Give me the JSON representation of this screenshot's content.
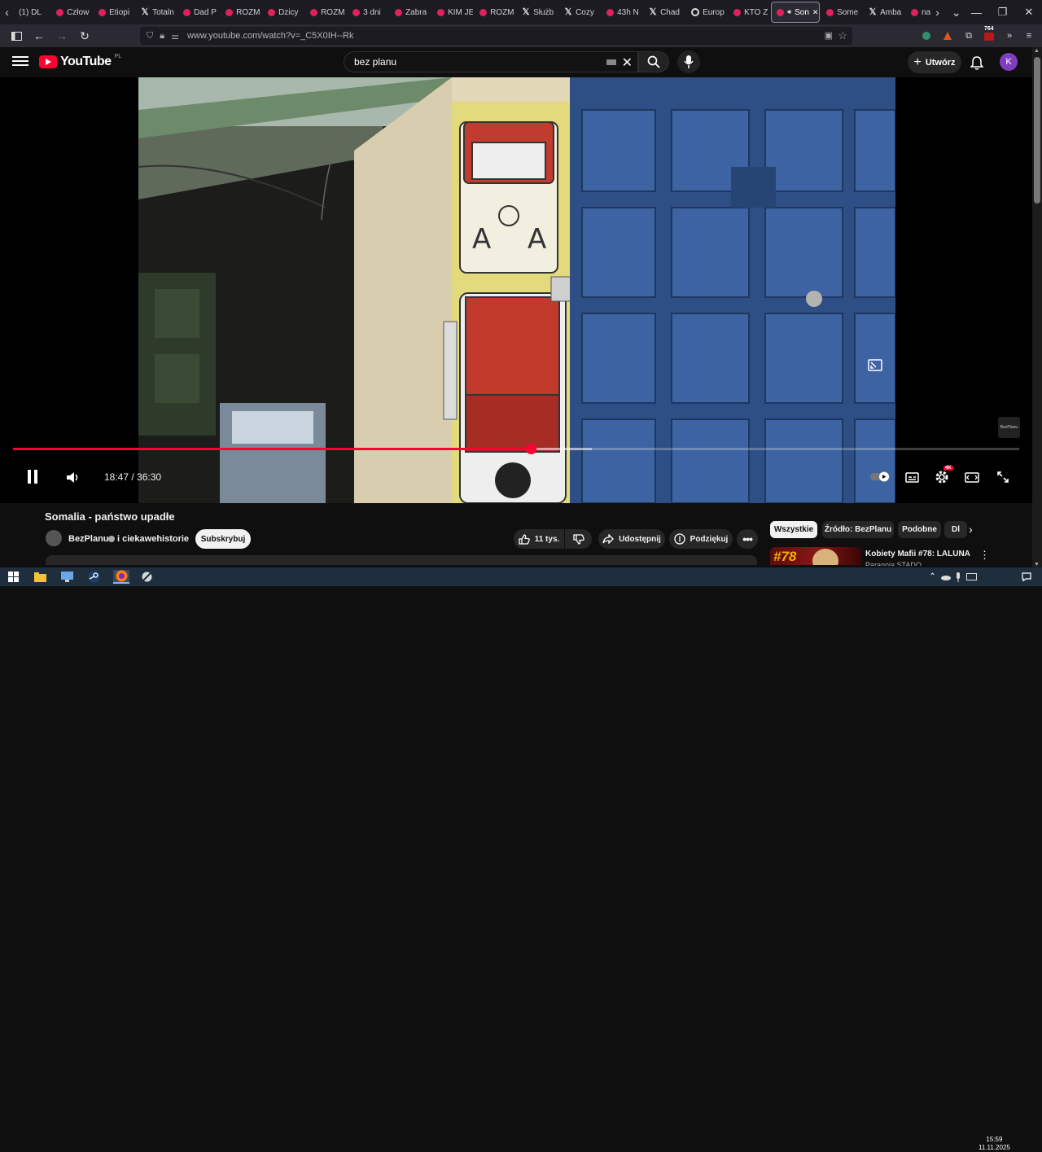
{
  "browser": {
    "tabs": [
      {
        "label": "(1) DL",
        "icon": "none"
      },
      {
        "label": "Człow",
        "icon": "youtube"
      },
      {
        "label": "Etiopi",
        "icon": "youtube"
      },
      {
        "label": "Totaln",
        "icon": "x"
      },
      {
        "label": "Dad P",
        "icon": "youtube"
      },
      {
        "label": "ROZM",
        "icon": "youtube"
      },
      {
        "label": "Dzicy",
        "icon": "youtube"
      },
      {
        "label": "ROZM",
        "icon": "youtube"
      },
      {
        "label": "3 dni",
        "icon": "youtube"
      },
      {
        "label": "Zabra",
        "icon": "youtube"
      },
      {
        "label": "KIM JE",
        "icon": "youtube"
      },
      {
        "label": "ROZM",
        "icon": "youtube"
      },
      {
        "label": "Służb",
        "icon": "x"
      },
      {
        "label": "Cozy",
        "icon": "x"
      },
      {
        "label": "43h N",
        "icon": "youtube"
      },
      {
        "label": "Chad",
        "icon": "x"
      },
      {
        "label": "Europ",
        "icon": "circle"
      },
      {
        "label": "KTO Z",
        "icon": "youtube"
      },
      {
        "label": "Son",
        "icon": "youtube",
        "active": true
      },
      {
        "label": "Some",
        "icon": "youtube"
      },
      {
        "label": "Amba",
        "icon": "x"
      },
      {
        "label": "nasz",
        "icon": "youtube"
      }
    ],
    "url": "www.youtube.com/watch?v=_C5X0IH--Rk",
    "extension_badge": "764"
  },
  "youtube": {
    "logo_text": "YouTube",
    "logo_country": "PL",
    "search_query": "bez planu",
    "create_label": "Utwórz",
    "avatar_letter": "K"
  },
  "player": {
    "current_time": "18:47",
    "duration": "36:30",
    "time_display": "18:47 / 36:30",
    "progress_fraction": 0.5146,
    "buffered_fraction": 0.575,
    "quality_badge": "4K",
    "watermark": "BezPlanu"
  },
  "video": {
    "title": "Somalia - państwo upadłe",
    "channel": "BezPlanu",
    "collab": "i ciekawehistorie",
    "subscribe_label": "Subskrybuj",
    "likes_label": "11 tys.",
    "share_label": "Udostępnij",
    "thanks_label": "Podziękuj"
  },
  "sidebar": {
    "chips": [
      "Wszystkie",
      "Źródło: BezPlanu",
      "Podobne",
      "Dl"
    ],
    "recommended": {
      "thumb_text": "#78",
      "title": "Kobiety Mafii #78: LALUNA",
      "channel": "Paranoja STADO"
    }
  },
  "taskbar": {
    "time": "15:59",
    "date": "11.11.2025"
  },
  "colors": {
    "accent": "#ff0033",
    "background": "#0f0f0f",
    "browser_chrome": "#2b2a33",
    "taskbar": "#1f2e3d"
  }
}
